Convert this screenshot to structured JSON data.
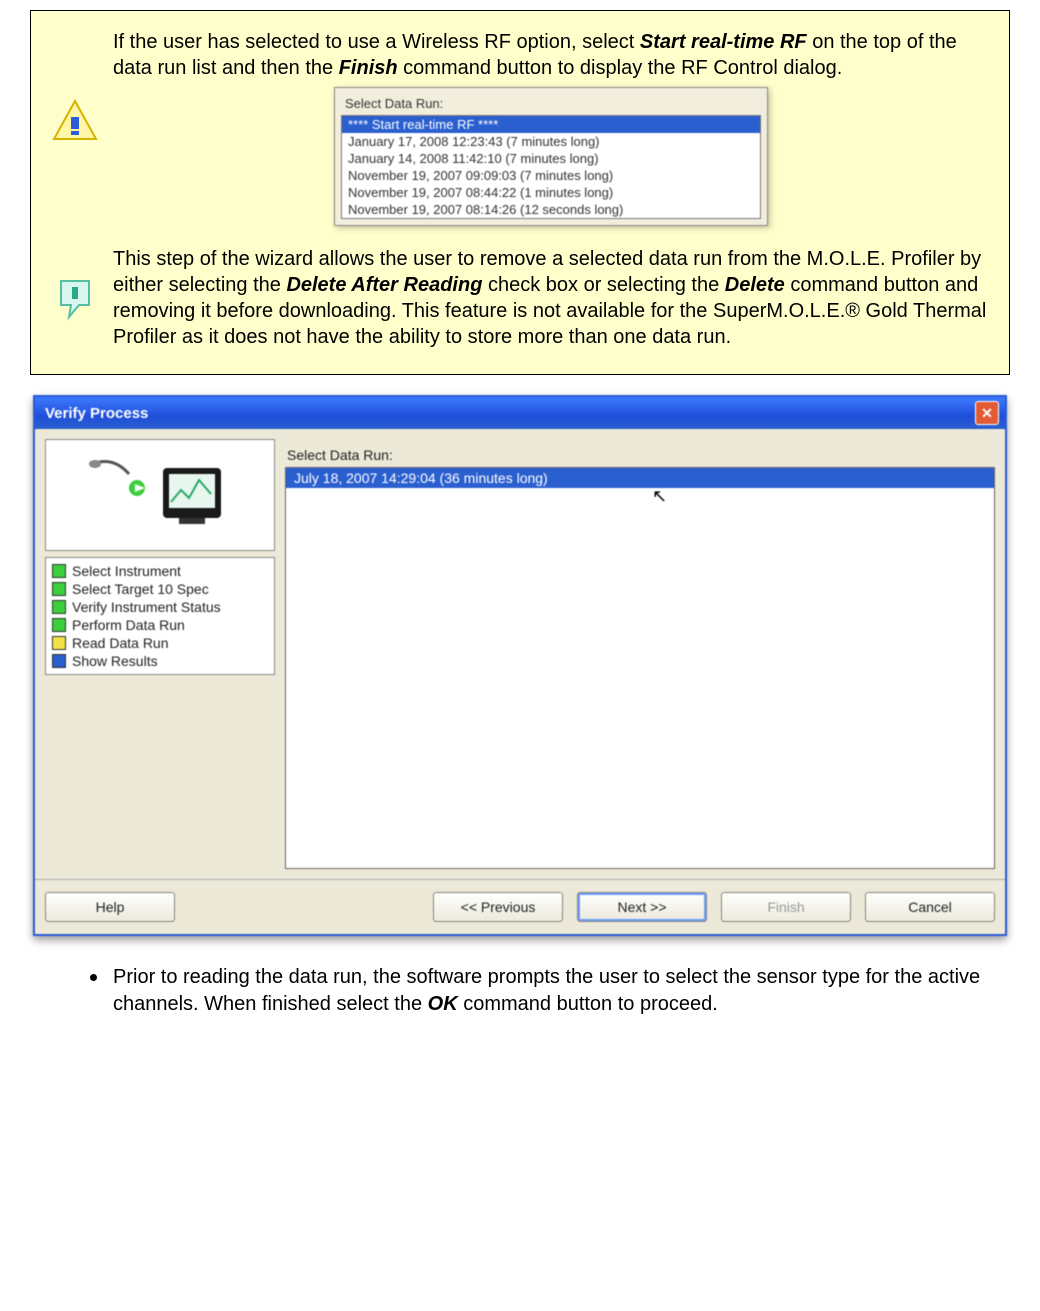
{
  "note1": {
    "pre": "If the user has selected to use a Wireless RF option, select ",
    "b1": "Start real-time RF",
    "mid1": " on the top of the data run list and then the ",
    "b2": "Finish",
    "post": " command button to display the RF Control dialog."
  },
  "inset": {
    "label": "Select Data Run:",
    "rows": [
      "**** Start real-time RF ****",
      "January 17, 2008    12:23:43 (7 minutes long)",
      "January 14, 2008    11:42:10 (7 minutes long)",
      "November 19, 2007   09:09:03 (7 minutes long)",
      "November 19, 2007   08:44:22 (1 minutes long)",
      "November 19, 2007   08:14:26 (12 seconds long)"
    ]
  },
  "note2": {
    "pre": "This step of the wizard allows the user to remove a selected data run from the M.O.L.E. Profiler by either selecting the ",
    "b1": "Delete After Reading",
    "mid1": " check box or selecting the ",
    "b2": "Delete",
    "post": " command button and removing it before downloading. This feature is not available for the SuperM.O.L.E.® Gold Thermal Profiler as it does not have the ability to store more than one data run."
  },
  "dialog": {
    "title": "Verify Process",
    "steps": [
      {
        "color": "g",
        "label": "Select Instrument"
      },
      {
        "color": "g",
        "label": "Select Target 10 Spec"
      },
      {
        "color": "g",
        "label": "Verify Instrument Status"
      },
      {
        "color": "g",
        "label": "Perform Data Run"
      },
      {
        "color": "y",
        "label": "Read Data Run"
      },
      {
        "color": "b",
        "label": "Show Results"
      }
    ],
    "list_label": "Select Data Run:",
    "list_rows": [
      "July 18, 2007   14:29:04   (36 minutes long)"
    ],
    "buttons": {
      "help": "Help",
      "prev": "<< Previous",
      "next": "Next >>",
      "finish": "Finish",
      "cancel": "Cancel"
    }
  },
  "bullet": {
    "pre": "Prior to reading the data run, the software prompts the user to select the sensor type for the active channels. When finished select the ",
    "b1": "OK",
    "post": " command button to proceed."
  }
}
